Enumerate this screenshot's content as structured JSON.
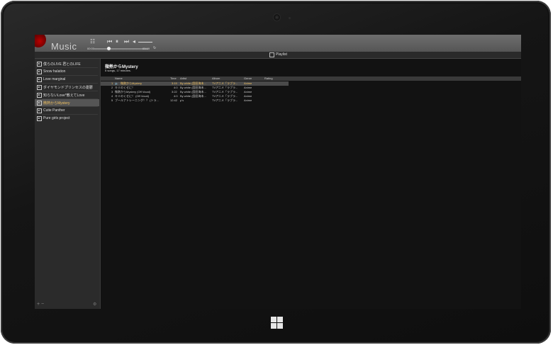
{
  "app": {
    "name": "Music"
  },
  "player": {
    "prev_icon": "⏮",
    "play_icon": "⏵",
    "pause_icon": "⏸",
    "next_icon": "⏭",
    "vol_icon": "◂",
    "elapsed": "00:00",
    "total": "03:19",
    "loop_icon": "↻"
  },
  "playlist_header": {
    "label": "Playlist"
  },
  "sidebar": {
    "items": [
      {
        "label": "僕らのLIVE 君とのLIFE",
        "selected": false
      },
      {
        "label": "Snow halation",
        "selected": false
      },
      {
        "label": "Love marginal",
        "selected": false
      },
      {
        "label": "ダイヤモンドプリンセスの憂鬱",
        "selected": false
      },
      {
        "label": "知らないLove*教えてLove",
        "selected": false
      },
      {
        "label": "微熱からMystery",
        "selected": true
      },
      {
        "label": "Cutie Panther",
        "selected": false
      },
      {
        "label": "Pure girls project",
        "selected": false
      }
    ],
    "footer": "+ −",
    "gear_icon": "⚙"
  },
  "main": {
    "title": "微熱からMystery",
    "subtitle": "5 songs, 17 minutes.",
    "columns": [
      "Name",
      "Time",
      "Artist",
      "Album",
      "Genre",
      "Rating"
    ],
    "rows": [
      {
        "num": "1",
        "name": "微熱からMystery",
        "time": "3:19",
        "artist": "By white (園田海未...",
        "album": "TVアニメ「ラブラ...",
        "genre": "Anime"
      },
      {
        "num": "2",
        "name": "キミのくせに！",
        "time": "4:0",
        "artist": "By white (園田海未...",
        "album": "TVアニメ「ラブラ...",
        "genre": "Anime"
      },
      {
        "num": "3",
        "name": "微熱からMystery (Off Vocal)",
        "time": "3:22",
        "artist": "By white (園田海未...",
        "album": "TVアニメ「ラブラ...",
        "genre": "Anime"
      },
      {
        "num": "4",
        "name": "キミのくせに！ (Off Vocal)",
        "time": "4:0",
        "artist": "By white (園田海未...",
        "album": "TVアニメ「ラブラ...",
        "genre": "Anime"
      },
      {
        "num": "5",
        "name": "ブールナトレーニング！？ (トラ...",
        "time": "12:42",
        "artist": "μ's",
        "album": "TVアニメ「ラブラ...",
        "genre": "Anime"
      }
    ]
  }
}
